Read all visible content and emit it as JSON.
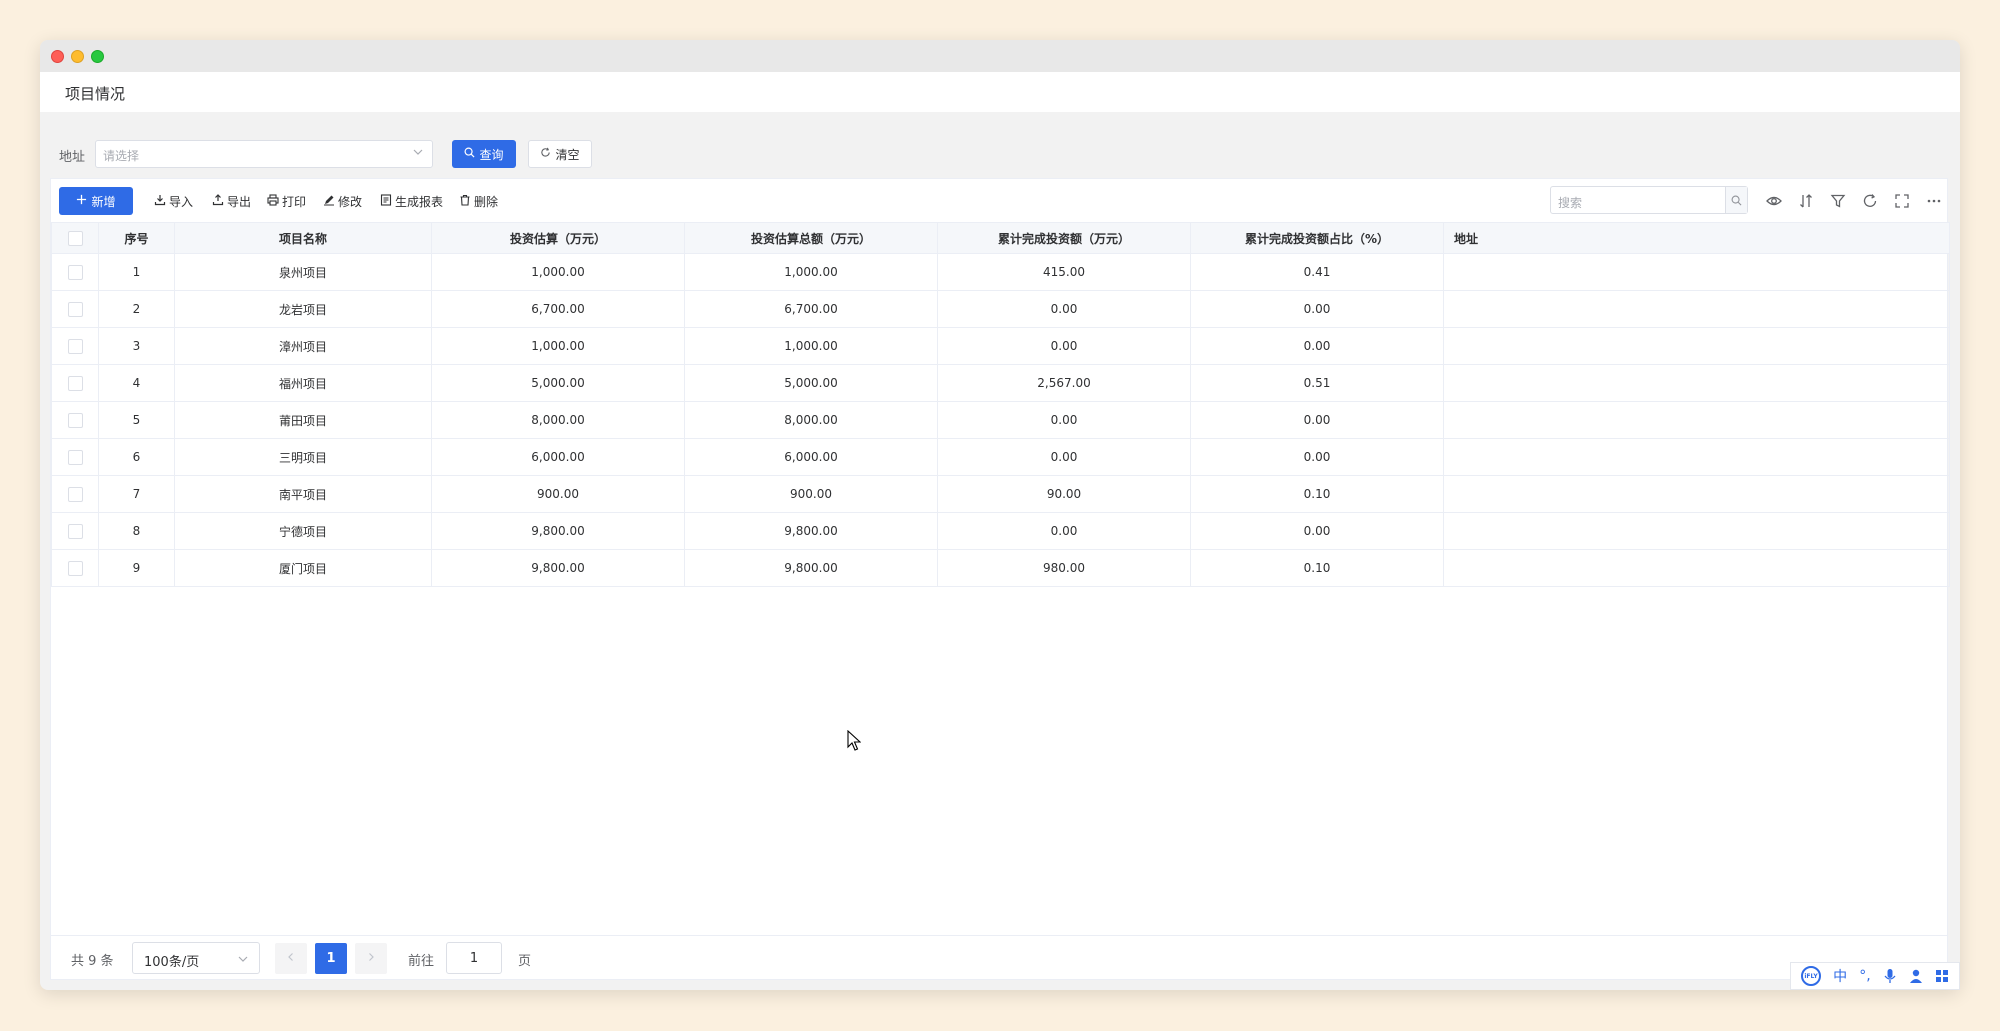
{
  "window": {
    "tab_title": "项目情况"
  },
  "filter": {
    "address_label": "地址",
    "address_placeholder": "请选择",
    "query_label": "查询",
    "clear_label": "清空"
  },
  "toolbar": {
    "add_label": "新增",
    "import_label": "导入",
    "export_label": "导出",
    "print_label": "打印",
    "edit_label": "修改",
    "report_label": "生成报表",
    "delete_label": "删除",
    "search_placeholder": "搜索"
  },
  "table": {
    "columns": [
      "序号",
      "项目名称",
      "投资估算（万元）",
      "投资估算总额（万元）",
      "累计完成投资额（万元）",
      "累计完成投资额占比（%）",
      "地址"
    ],
    "rows": [
      {
        "no": "1",
        "name": "泉州项目",
        "estimate": "1,000.00",
        "estimate_total": "1,000.00",
        "completed": "415.00",
        "ratio": "0.41",
        "address": ""
      },
      {
        "no": "2",
        "name": "龙岩项目",
        "estimate": "6,700.00",
        "estimate_total": "6,700.00",
        "completed": "0.00",
        "ratio": "0.00",
        "address": ""
      },
      {
        "no": "3",
        "name": "漳州项目",
        "estimate": "1,000.00",
        "estimate_total": "1,000.00",
        "completed": "0.00",
        "ratio": "0.00",
        "address": ""
      },
      {
        "no": "4",
        "name": "福州项目",
        "estimate": "5,000.00",
        "estimate_total": "5,000.00",
        "completed": "2,567.00",
        "ratio": "0.51",
        "address": ""
      },
      {
        "no": "5",
        "name": "莆田项目",
        "estimate": "8,000.00",
        "estimate_total": "8,000.00",
        "completed": "0.00",
        "ratio": "0.00",
        "address": ""
      },
      {
        "no": "6",
        "name": "三明项目",
        "estimate": "6,000.00",
        "estimate_total": "6,000.00",
        "completed": "0.00",
        "ratio": "0.00",
        "address": ""
      },
      {
        "no": "7",
        "name": "南平项目",
        "estimate": "900.00",
        "estimate_total": "900.00",
        "completed": "90.00",
        "ratio": "0.10",
        "address": ""
      },
      {
        "no": "8",
        "name": "宁德项目",
        "estimate": "9,800.00",
        "estimate_total": "9,800.00",
        "completed": "0.00",
        "ratio": "0.00",
        "address": ""
      },
      {
        "no": "9",
        "name": "厦门项目",
        "estimate": "9,800.00",
        "estimate_total": "9,800.00",
        "completed": "980.00",
        "ratio": "0.10",
        "address": ""
      }
    ]
  },
  "pagination": {
    "total_text": "共 9 条",
    "page_size": "100条/页",
    "current_page": "1",
    "goto_label": "前往",
    "goto_value": "1",
    "goto_suffix": "页"
  },
  "ime": {
    "logo": "iFLY",
    "lang": "中",
    "punct": "°,"
  },
  "colors": {
    "primary": "#2f6be6",
    "desktop_bg": "#fbf0df",
    "header_bg": "#f5f7fa",
    "border": "#ebeef5"
  },
  "icons": [
    "plus-icon",
    "import-icon",
    "export-icon",
    "print-icon",
    "edit-icon",
    "report-icon",
    "delete-icon",
    "search-icon",
    "eye-icon",
    "sort-icon",
    "filter-icon",
    "refresh-icon",
    "fullscreen-icon",
    "more-icon",
    "chevron-down-icon",
    "chevron-left-icon",
    "chevron-right-icon",
    "microphone-icon",
    "user-icon",
    "grid-icon"
  ]
}
